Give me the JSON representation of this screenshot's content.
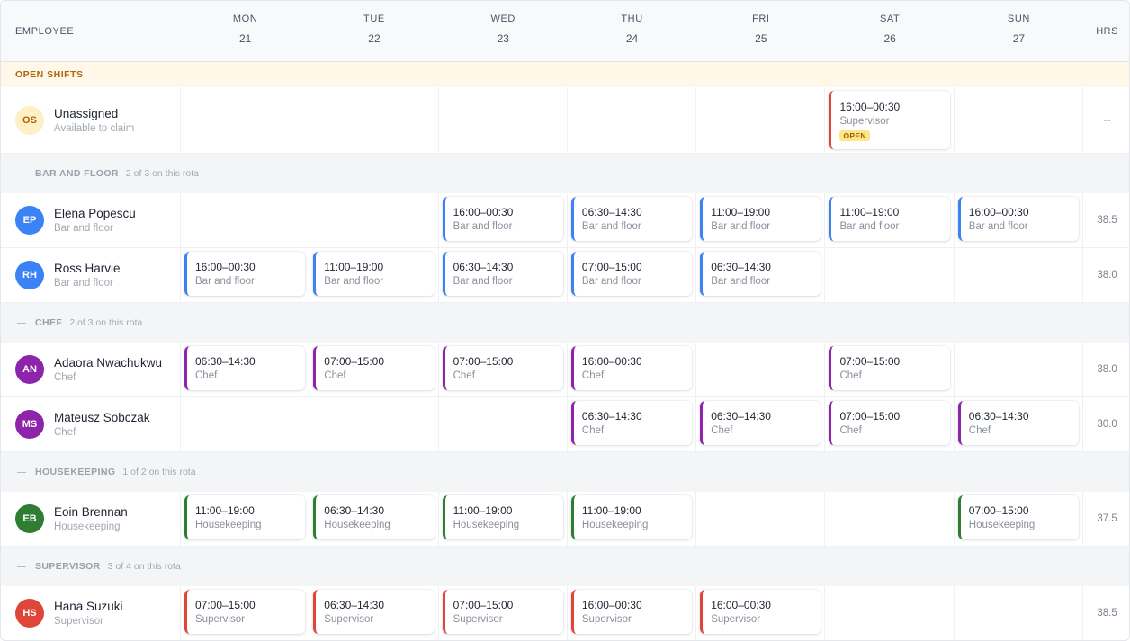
{
  "header": {
    "employee_label": "EMPLOYEE",
    "hours_label": "HRS",
    "days": [
      {
        "name": "MON",
        "date": "21"
      },
      {
        "name": "TUE",
        "date": "22"
      },
      {
        "name": "WED",
        "date": "23"
      },
      {
        "name": "THU",
        "date": "24"
      },
      {
        "name": "FRI",
        "date": "25"
      },
      {
        "name": "SAT",
        "date": "26"
      },
      {
        "name": "SUN",
        "date": "27"
      }
    ]
  },
  "open_shifts": {
    "label": "OPEN SHIFTS",
    "employee": {
      "initials": "OS",
      "name": "Unassigned",
      "role": "Available to claim",
      "hours": "--",
      "avatar_bg": "#fdf0c4",
      "avatar_fg": "#b0640e",
      "shifts": [
        null,
        null,
        null,
        null,
        null,
        {
          "time": "16:00–00:30",
          "role": "Supervisor",
          "badge": "OPEN",
          "color": "#e0453a"
        },
        null
      ]
    }
  },
  "groups": [
    {
      "name": "BAR AND FLOOR",
      "count": "2 of 3 on this rota",
      "employees": [
        {
          "initials": "EP",
          "name": "Elena Popescu",
          "role": "Bar and floor",
          "hours": "38.5",
          "avatar_bg": "#3b82f6",
          "shifts": [
            null,
            null,
            {
              "time": "16:00–00:30",
              "role": "Bar and floor",
              "color": "#3b82f6"
            },
            {
              "time": "06:30–14:30",
              "role": "Bar and floor",
              "color": "#3b82f6"
            },
            {
              "time": "11:00–19:00",
              "role": "Bar and floor",
              "color": "#3b82f6"
            },
            {
              "time": "11:00–19:00",
              "role": "Bar and floor",
              "color": "#3b82f6"
            },
            {
              "time": "16:00–00:30",
              "role": "Bar and floor",
              "color": "#3b82f6"
            }
          ]
        },
        {
          "initials": "RH",
          "name": "Ross Harvie",
          "role": "Bar and floor",
          "hours": "38.0",
          "avatar_bg": "#3b82f6",
          "shifts": [
            {
              "time": "16:00–00:30",
              "role": "Bar and floor",
              "color": "#3b82f6"
            },
            {
              "time": "11:00–19:00",
              "role": "Bar and floor",
              "color": "#3b82f6"
            },
            {
              "time": "06:30–14:30",
              "role": "Bar and floor",
              "color": "#3b82f6"
            },
            {
              "time": "07:00–15:00",
              "role": "Bar and floor",
              "color": "#3b82f6"
            },
            {
              "time": "06:30–14:30",
              "role": "Bar and floor",
              "color": "#3b82f6"
            },
            null,
            null
          ]
        }
      ]
    },
    {
      "name": "CHEF",
      "count": "2 of 3 on this rota",
      "employees": [
        {
          "initials": "AN",
          "name": "Adaora Nwachukwu",
          "role": "Chef",
          "hours": "38.0",
          "avatar_bg": "#8e24aa",
          "shifts": [
            {
              "time": "06:30–14:30",
              "role": "Chef",
              "color": "#8e24aa"
            },
            {
              "time": "07:00–15:00",
              "role": "Chef",
              "color": "#8e24aa"
            },
            {
              "time": "07:00–15:00",
              "role": "Chef",
              "color": "#8e24aa"
            },
            {
              "time": "16:00–00:30",
              "role": "Chef",
              "color": "#8e24aa"
            },
            null,
            {
              "time": "07:00–15:00",
              "role": "Chef",
              "color": "#8e24aa"
            },
            null
          ]
        },
        {
          "initials": "MS",
          "name": "Mateusz Sobczak",
          "role": "Chef",
          "hours": "30.0",
          "avatar_bg": "#8e24aa",
          "shifts": [
            null,
            null,
            null,
            {
              "time": "06:30–14:30",
              "role": "Chef",
              "color": "#8e24aa"
            },
            {
              "time": "06:30–14:30",
              "role": "Chef",
              "color": "#8e24aa"
            },
            {
              "time": "07:00–15:00",
              "role": "Chef",
              "color": "#8e24aa"
            },
            {
              "time": "06:30–14:30",
              "role": "Chef",
              "color": "#8e24aa"
            }
          ]
        }
      ]
    },
    {
      "name": "HOUSEKEEPING",
      "count": "1 of 2 on this rota",
      "employees": [
        {
          "initials": "EB",
          "name": "Eoin Brennan",
          "role": "Housekeeping",
          "hours": "37.5",
          "avatar_bg": "#2e7d32",
          "shifts": [
            {
              "time": "11:00–19:00",
              "role": "Housekeeping",
              "color": "#2e7d32"
            },
            {
              "time": "06:30–14:30",
              "role": "Housekeeping",
              "color": "#2e7d32"
            },
            {
              "time": "11:00–19:00",
              "role": "Housekeeping",
              "color": "#2e7d32"
            },
            {
              "time": "11:00–19:00",
              "role": "Housekeeping",
              "color": "#2e7d32"
            },
            null,
            null,
            {
              "time": "07:00–15:00",
              "role": "Housekeeping",
              "color": "#2e7d32"
            }
          ]
        }
      ]
    },
    {
      "name": "SUPERVISOR",
      "count": "3 of 4 on this rota",
      "employees": [
        {
          "initials": "HS",
          "name": "Hana Suzuki",
          "role": "Supervisor",
          "hours": "38.5",
          "avatar_bg": "#e0453a",
          "shifts": [
            {
              "time": "07:00–15:00",
              "role": "Supervisor",
              "color": "#e0453a"
            },
            {
              "time": "06:30–14:30",
              "role": "Supervisor",
              "color": "#e0453a"
            },
            {
              "time": "07:00–15:00",
              "role": "Supervisor",
              "color": "#e0453a"
            },
            {
              "time": "16:00–00:30",
              "role": "Supervisor",
              "color": "#e0453a"
            },
            {
              "time": "16:00–00:30",
              "role": "Supervisor",
              "color": "#e0453a"
            },
            null,
            null
          ]
        }
      ]
    }
  ]
}
